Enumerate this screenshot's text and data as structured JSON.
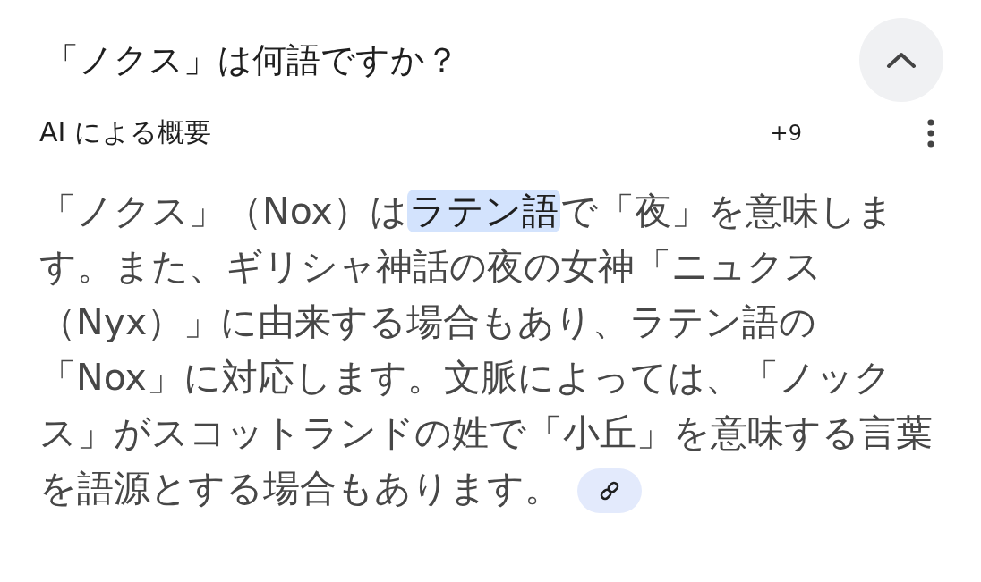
{
  "question": "「ノクス」は何語ですか？",
  "collapse": {
    "expanded": true
  },
  "overview": {
    "label": "AI による概要",
    "count": "+9"
  },
  "answer": [
    {
      "text": "「ノクス」（Nox）は",
      "highlighted": false
    },
    {
      "text": "ラテン語",
      "highlighted": true
    },
    {
      "text": "で「夜」を意味します。また、ギリシャ神話の夜の女神「ニュクス（Nyx）」に由来する場合もあり、ラテン語の「Nox」に対応します。文脈によっては、「ノックス」がスコットランドの姓で「小丘」を意味する言葉を語源とする場合もあります。",
      "highlighted": false
    }
  ]
}
